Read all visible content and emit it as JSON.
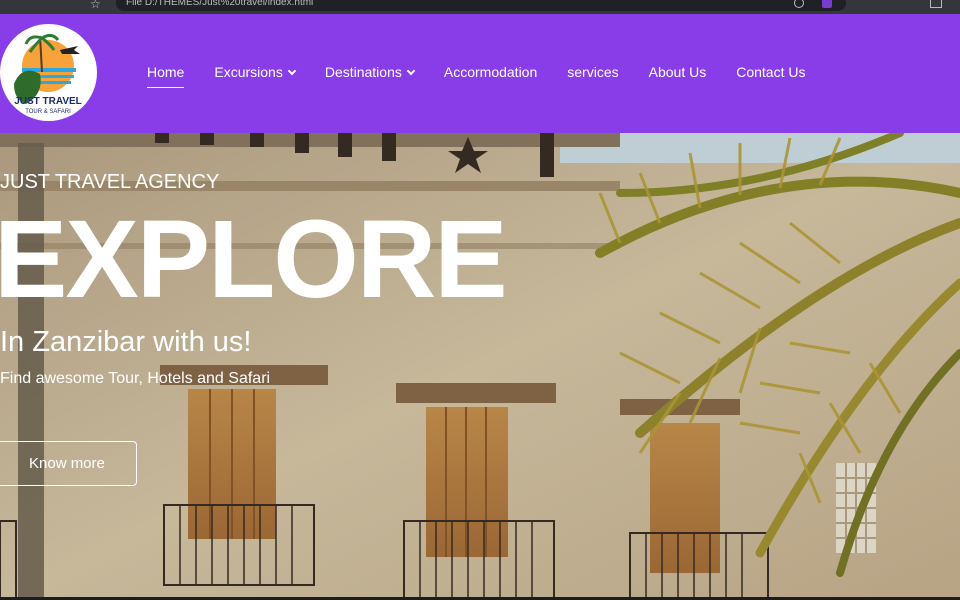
{
  "browser": {
    "url": "File  D:/THEMES/Just%20travel/index.html"
  },
  "logo": {
    "brand_line1": "JUST TRAVEL",
    "brand_line2": "TOUR & SAFARI"
  },
  "nav": {
    "items": [
      {
        "label": "Home",
        "active": true
      },
      {
        "label": "Excursions",
        "dropdown": true
      },
      {
        "label": "Destinations",
        "dropdown": true
      },
      {
        "label": "Accormodation"
      },
      {
        "label": "services"
      },
      {
        "label": "About Us"
      },
      {
        "label": "Contact Us"
      }
    ]
  },
  "hero": {
    "eyebrow": "JUST TRAVEL AGENCY",
    "title": "EXPLORE",
    "subtitle": "In Zanzibar with us!",
    "text": "Find awesome Tour, Hotels and Safari",
    "button": "Know more"
  },
  "colors": {
    "nav_bg": "#883de9",
    "text": "#ffffff"
  }
}
